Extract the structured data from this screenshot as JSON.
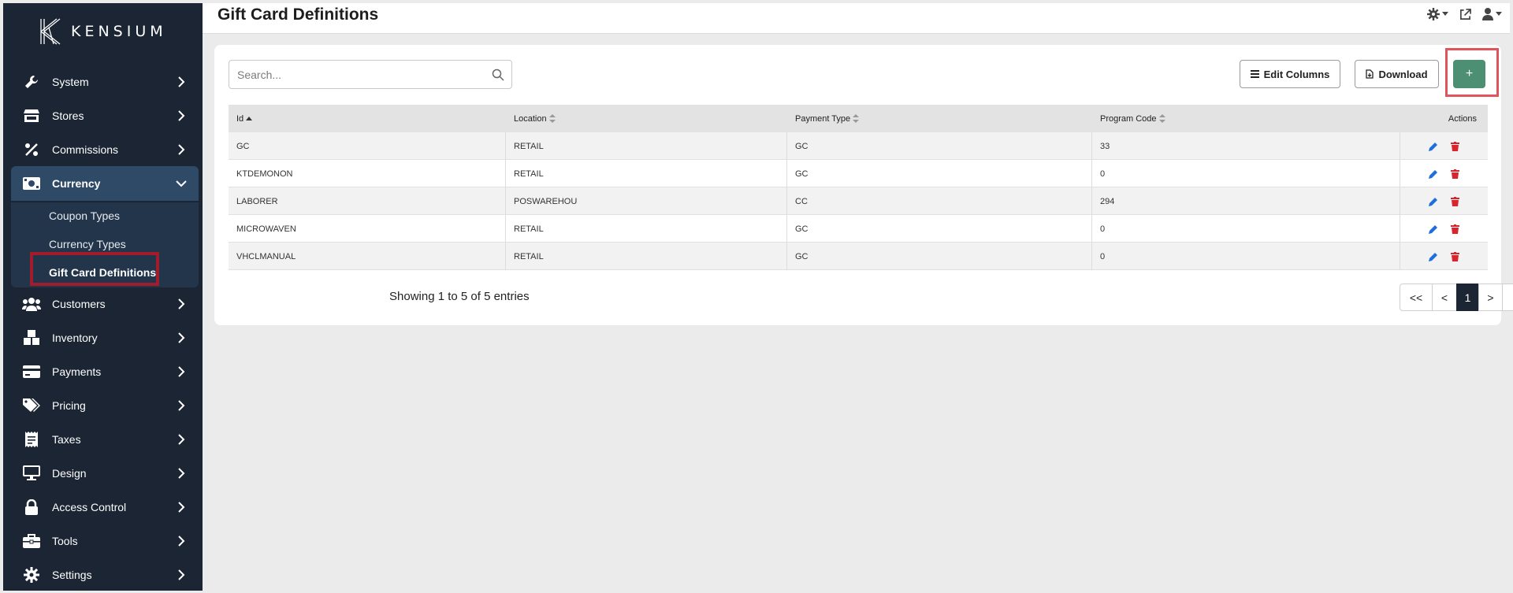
{
  "brand": {
    "name": "KENSIUM"
  },
  "header": {
    "title": "Gift Card Definitions"
  },
  "sidebar": {
    "items": [
      {
        "label": "System",
        "icon": "wrench-icon"
      },
      {
        "label": "Stores",
        "icon": "store-icon"
      },
      {
        "label": "Commissions",
        "icon": "percent-icon"
      },
      {
        "label": "Currency",
        "icon": "money-bill-icon"
      },
      {
        "label": "Customers",
        "icon": "users-icon"
      },
      {
        "label": "Inventory",
        "icon": "boxes-icon"
      },
      {
        "label": "Payments",
        "icon": "credit-card-icon"
      },
      {
        "label": "Pricing",
        "icon": "tags-icon"
      },
      {
        "label": "Taxes",
        "icon": "receipt-icon"
      },
      {
        "label": "Design",
        "icon": "monitor-icon"
      },
      {
        "label": "Access Control",
        "icon": "lock-icon"
      },
      {
        "label": "Tools",
        "icon": "toolbox-icon"
      },
      {
        "label": "Settings",
        "icon": "gear-icon"
      }
    ],
    "currency_submenu": [
      {
        "label": "Coupon Types"
      },
      {
        "label": "Currency Types"
      },
      {
        "label": "Gift Card Definitions"
      }
    ]
  },
  "toolbar": {
    "search_placeholder": "Search...",
    "edit_columns_label": "Edit Columns",
    "download_label": "Download",
    "add_label": "+"
  },
  "table": {
    "columns": [
      "Id",
      "Location",
      "Payment Type",
      "Program Code",
      "Actions"
    ],
    "rows": [
      {
        "id": "GC",
        "location": "RETAIL",
        "payment_type": "GC",
        "program_code": "33"
      },
      {
        "id": "KTDEMONON",
        "location": "RETAIL",
        "payment_type": "GC",
        "program_code": "0"
      },
      {
        "id": "LABORER",
        "location": "POSWAREHOU",
        "payment_type": "CC",
        "program_code": "294"
      },
      {
        "id": "MICROWAVEN",
        "location": "RETAIL",
        "payment_type": "GC",
        "program_code": "0"
      },
      {
        "id": "VHCLMANUAL",
        "location": "RETAIL",
        "payment_type": "GC",
        "program_code": "0"
      }
    ]
  },
  "footer": {
    "showing": "Showing 1 to 5 of 5 entries"
  },
  "pagination": {
    "first": "<<",
    "prev": "<",
    "current": "1",
    "next": ">",
    "last": ">>"
  },
  "colors": {
    "sidebar_bg": "#1b2533",
    "accent_green": "#4d8f72",
    "edit_blue": "#1e6fdc",
    "delete_red": "#d9232d"
  }
}
